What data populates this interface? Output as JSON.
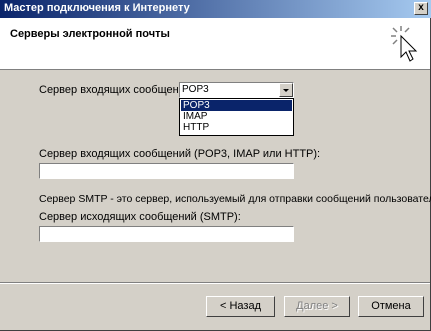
{
  "window": {
    "title": "Мастер подключения к Интернету",
    "close_glyph": "x"
  },
  "header": {
    "title": "Серверы электронной почты",
    "icon": "wizard-icon"
  },
  "incoming_type": {
    "label": "Сервер входящих сообщений:",
    "selected": "POP3",
    "options": [
      "POP3",
      "IMAP",
      "HTTP"
    ]
  },
  "incoming_server": {
    "label": "Сервер входящих сообщений (POP3, IMAP или HTTP):",
    "value": ""
  },
  "smtp_description": "Сервер SMTP - это сервер, используемый для отправки сообщений пользователя.",
  "outgoing_server": {
    "label": "Сервер исходящих сообщений (SMTP):",
    "value": ""
  },
  "buttons": {
    "back": "< Назад",
    "next": "Далее >",
    "cancel": "Отмена"
  }
}
